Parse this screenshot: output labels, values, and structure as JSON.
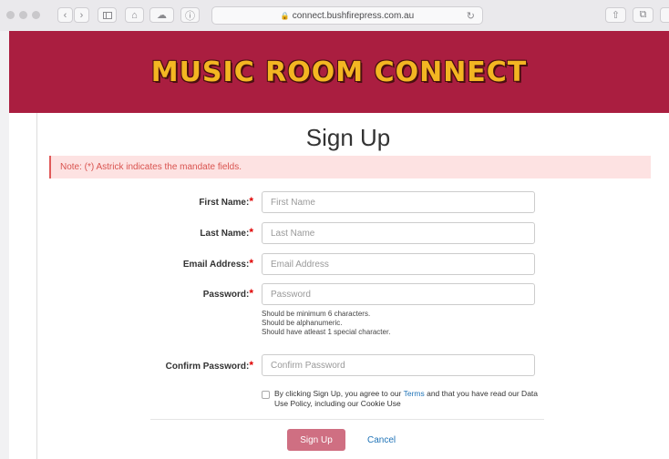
{
  "browser": {
    "url": "connect.bushfirepress.com.au"
  },
  "banner": {
    "logo_text": "MUSIC ROOM CONNECT",
    "bg_color": "#aa1e40",
    "logo_color": "#f3b622"
  },
  "page": {
    "title": "Sign Up",
    "note": "Note: (*) Astrick indicates the mandate fields."
  },
  "form": {
    "required_mark": "*",
    "first_name": {
      "label": "First Name:",
      "placeholder": "First Name"
    },
    "last_name": {
      "label": "Last Name:",
      "placeholder": "Last Name"
    },
    "email": {
      "label": "Email Address:",
      "placeholder": "Email Address"
    },
    "password": {
      "label": "Password:",
      "placeholder": "Password",
      "hints": [
        "Should be minimum 6 characters.",
        "Should be alphanumeric.",
        "Should have atleast 1 special character."
      ]
    },
    "confirm_password": {
      "label": "Confirm Password:",
      "placeholder": "Confirm Password"
    },
    "agree": {
      "before": "By clicking Sign Up, you agree to our ",
      "terms_link": "Terms",
      "after": " and that you have read our Data Use Policy, including our Cookie Use"
    },
    "submit_label": "Sign Up",
    "cancel_label": "Cancel"
  }
}
